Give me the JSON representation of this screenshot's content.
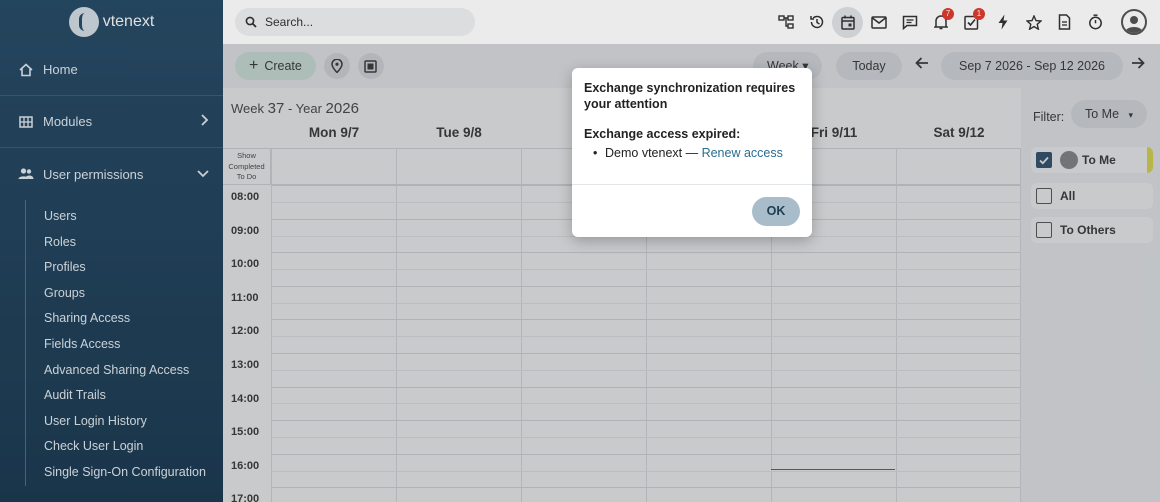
{
  "sidebar": {
    "brand": "vtenext",
    "items": [
      {
        "label": "Home"
      },
      {
        "label": "Modules"
      },
      {
        "label": "User permissions"
      }
    ],
    "submenu": [
      "Users",
      "Roles",
      "Profiles",
      "Groups",
      "Sharing Access",
      "Fields Access",
      "Advanced Sharing Access",
      "Audit Trails",
      "User Login History",
      "Check User Login",
      "Single Sign-On Configuration"
    ]
  },
  "topbar": {
    "search_placeholder": "Search...",
    "notifications_badge": "7",
    "todo_badge": "1"
  },
  "toolbar": {
    "create_label": "Create",
    "view_label": "Week",
    "today_label": "Today",
    "date_range": "Sep 7 2026 - Sep 12 2026"
  },
  "calendar": {
    "week_prefix": "Week",
    "week_number": "37",
    "year_prefix": "- Year",
    "year": "2026",
    "days": [
      "Mon 9/7",
      "Tue 9/8",
      "W",
      "",
      "Fri 9/11",
      "Sat 9/12"
    ],
    "show_completed": [
      "Show",
      "Completed",
      "To Do"
    ],
    "times": [
      "08:00",
      "09:00",
      "10:00",
      "11:00",
      "12:00",
      "13:00",
      "14:00",
      "15:00",
      "16:00",
      "17:00"
    ]
  },
  "filter": {
    "label": "Filter:",
    "selected": "To Me",
    "options": [
      "To Me",
      "All",
      "To Others"
    ]
  },
  "modal": {
    "title": "Exchange synchronization requires your attention",
    "subtitle": "Exchange access expired:",
    "item_account": "Demo vtenext —",
    "item_link": "Renew access",
    "ok_label": "OK"
  },
  "colors": {
    "sidebar": "#2a4f6b",
    "accent": "#2a6e8f",
    "badge": "#e03b2f"
  }
}
